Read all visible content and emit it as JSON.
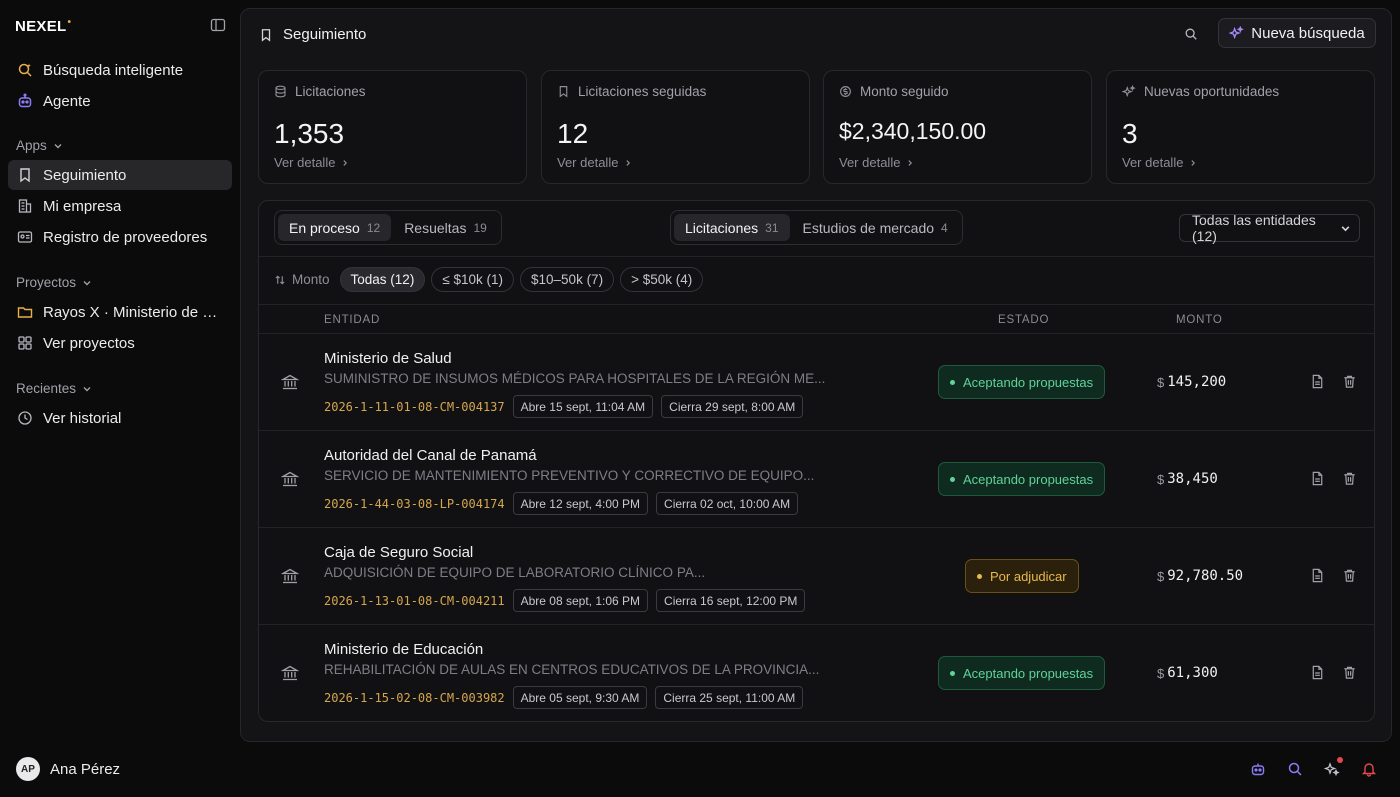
{
  "app": {
    "logo": "NEXEL",
    "logo_mark": "•"
  },
  "sidebar": {
    "primary": [
      {
        "label": "Búsqueda inteligente",
        "icon": "sparkle-search-icon"
      },
      {
        "label": "Agente",
        "icon": "robot-icon"
      }
    ],
    "apps_label": "Apps",
    "apps": [
      {
        "label": "Seguimiento",
        "icon": "bookmark-icon",
        "active": true
      },
      {
        "label": "Mi empresa",
        "icon": "building-icon"
      },
      {
        "label": "Registro de proveedores",
        "icon": "id-card-icon"
      }
    ],
    "projects_label": "Proyectos",
    "projects": [
      {
        "label": "Rayos X · Ministerio de Salud",
        "icon": "folder-icon"
      },
      {
        "label": "Ver proyectos",
        "icon": "grid-icon"
      }
    ],
    "recent_label": "Recientes",
    "recent": [
      {
        "label": "Ver historial",
        "icon": "clock-icon"
      }
    ],
    "user": {
      "initials": "AP",
      "name": "Ana Pérez"
    }
  },
  "header": {
    "title": "Seguimiento",
    "new_search": "Nueva búsqueda"
  },
  "cards": [
    {
      "title": "Licitaciones",
      "value": "1,353",
      "link": "Ver detalle",
      "icon": "database-icon"
    },
    {
      "title": "Licitaciones seguidas",
      "value": "12",
      "link": "Ver detalle",
      "icon": "bookmark-icon"
    },
    {
      "title": "Monto seguido",
      "value": "$2,340,150.00",
      "link": "Ver detalle",
      "icon": "dollar-icon"
    },
    {
      "title": "Nuevas oportunidades",
      "value": "3",
      "link": "Ver detalle",
      "icon": "sparkles-icon"
    }
  ],
  "tabs_status": [
    {
      "label": "En proceso",
      "count": "12",
      "active": true
    },
    {
      "label": "Resueltas",
      "count": "19",
      "active": false
    }
  ],
  "tabs_type": [
    {
      "label": "Licitaciones",
      "count": "31",
      "active": true
    },
    {
      "label": "Estudios de mercado",
      "count": "4",
      "active": false
    }
  ],
  "entity_filter": {
    "selected": "Todas las entidades (12)"
  },
  "filters": {
    "sort_label": "Monto",
    "chips": [
      "Todas (12)",
      "≤ $10k (1)",
      "$10–50k (7)",
      "> $50k (4)"
    ]
  },
  "columns": {
    "entity": "ENTIDAD",
    "status": "ESTADO",
    "amount": "MONTO"
  },
  "rows": [
    {
      "entity": "Ministerio de Salud",
      "description": "SUMINISTRO DE INSUMOS MÉDICOS PARA HOSPITALES DE LA REGIÓN ME...",
      "code": "2026-1-11-01-08-CM-004137",
      "opens": "Abre 15 sept, 11:04 AM",
      "closes": "Cierra 29 sept, 8:00 AM",
      "status": "Aceptando propuestas",
      "status_color": "#5fd39a",
      "currency": "$",
      "amount": "145,200"
    },
    {
      "entity": "Autoridad del Canal de Panamá",
      "description": "SERVICIO DE MANTENIMIENTO PREVENTIVO Y CORRECTIVO DE EQUIPO...",
      "code": "2026-1-44-03-08-LP-004174",
      "opens": "Abre 12 sept, 4:00 PM",
      "closes": "Cierra 02 oct, 10:00 AM",
      "status": "Aceptando propuestas",
      "status_color": "#5fd39a",
      "currency": "$",
      "amount": "38,450"
    },
    {
      "entity": "Caja de Seguro Social",
      "description": "ADQUISICIÓN DE EQUIPO DE LABORATORIO CLÍNICO PA...",
      "code": "2026-1-13-01-08-CM-004211",
      "opens": "Abre 08 sept, 1:06 PM",
      "closes": "Cierra 16 sept, 12:00 PM",
      "status": "Por adjudicar",
      "status_color": "#e8b94b",
      "currency": "$",
      "amount": "92,780.50"
    },
    {
      "entity": "Ministerio de Educación",
      "description": "REHABILITACIÓN DE AULAS EN CENTROS EDUCATIVOS DE LA PROVINCIA...",
      "code": "2026-1-15-02-08-CM-003982",
      "opens": "Abre 05 sept, 9:30 AM",
      "closes": "Cierra 25 sept, 11:00 AM",
      "status": "Aceptando propuestas",
      "status_color": "#5fd39a",
      "currency": "$",
      "amount": "61,300"
    }
  ]
}
